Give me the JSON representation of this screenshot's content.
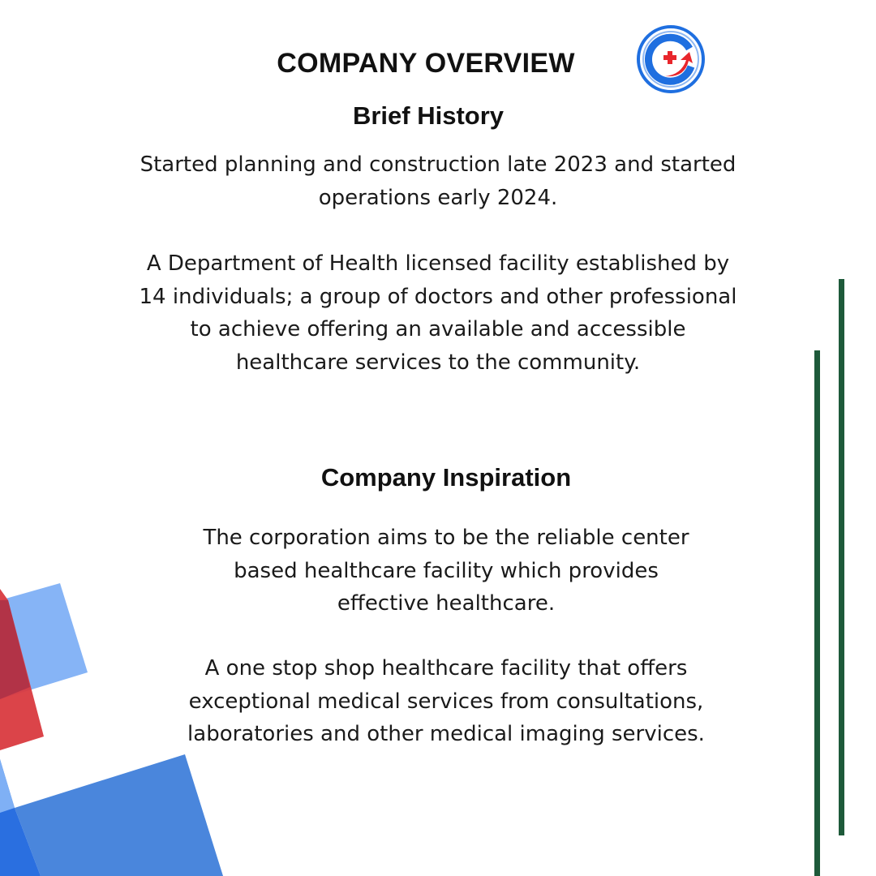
{
  "title": "COMPANY OVERVIEW",
  "logo": {
    "icon": "medical-cross-g-logo-icon",
    "colors": {
      "blue": "#1f6fe0",
      "red": "#e8262c"
    }
  },
  "sections": [
    {
      "heading": "Brief History",
      "paragraphs": [
        "Started planning and construction late 2023 and started operations early 2024.",
        "A Department of Health licensed facility established by 14 individuals; a group of doctors and other professional to achieve offering an available and accessible healthcare services to the community."
      ]
    },
    {
      "heading": "Company Inspiration",
      "paragraphs": [
        "The corporation aims to be the reliable center based healthcare facility which provides effective healthcare.",
        "A one stop shop healthcare facility that offers exceptional medical services from consultations, laboratories and other medical imaging services."
      ]
    }
  ],
  "colors": {
    "accent_green": "#1e5a3a",
    "shape_blue_light": "#7fb0f5",
    "shape_blue": "#3f7fe0",
    "shape_red": "#d93a3f",
    "shape_maroon": "#b23347"
  }
}
